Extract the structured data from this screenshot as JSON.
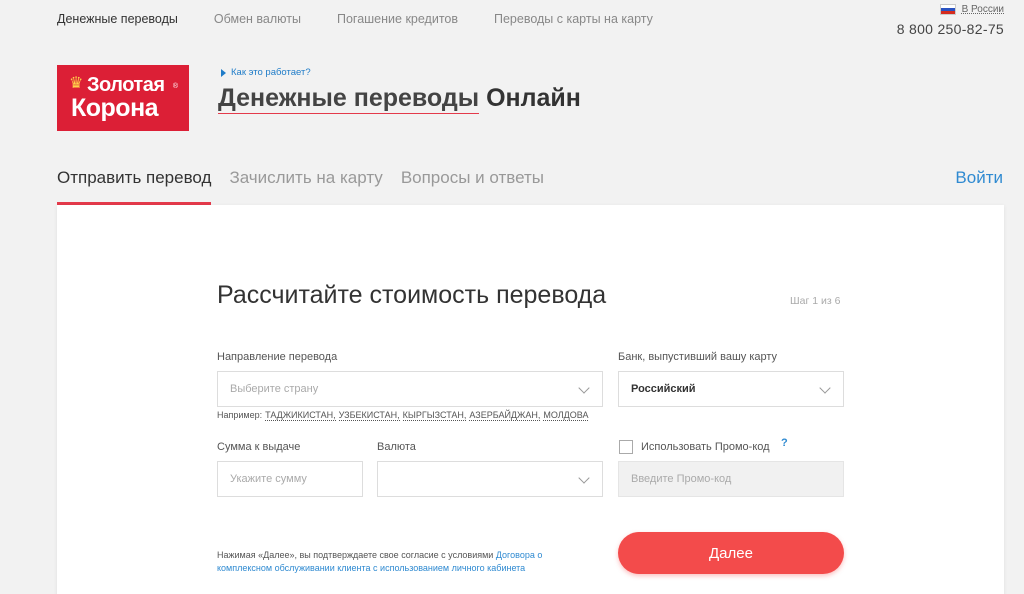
{
  "topnav": {
    "items": [
      "Денежные переводы",
      "Обмен валюты",
      "Погашение кредитов",
      "Переводы с карты на карту"
    ],
    "active_index": 0
  },
  "header": {
    "region": "В России",
    "phone": "8 800 250-82-75",
    "logo": {
      "line1": "Золотая",
      "line2": "Корона",
      "reg": "®"
    },
    "how_link": "Как это работает?",
    "title_part1": "Денежные переводы",
    "title_part2": "Онлайн"
  },
  "tabs": {
    "items": [
      "Отправить перевод",
      "Зачислить на карту",
      "Вопросы и ответы"
    ],
    "active_index": 0,
    "login": "Войти"
  },
  "form": {
    "title": "Рассчитайте стоимость перевода",
    "step": "Шаг 1 из 6",
    "direction": {
      "label": "Направление перевода",
      "placeholder": "Выберите страну"
    },
    "example": {
      "prefix": "Например:",
      "countries": [
        "ТАДЖИКИСТАН,",
        "УЗБЕКИСТАН,",
        "КЫРГЫЗСТАН,",
        "АЗЕРБАЙДЖАН,",
        "МОЛДОВА"
      ]
    },
    "bank": {
      "label": "Банк, выпустивший вашу карту",
      "value": "Российский"
    },
    "amount": {
      "label": "Сумма к выдаче",
      "placeholder": "Укажите сумму"
    },
    "currency": {
      "label": "Валюта",
      "value": ""
    },
    "promo": {
      "label": "Использовать Промо-код",
      "help": "?",
      "placeholder": "Введите Промо-код",
      "checked": false
    },
    "terms": {
      "text": "Нажимая «Далее», вы подтверждаете свое согласие с условиями ",
      "link": "Договора о комплексном обслуживании клиента с использованием личного кабинета"
    },
    "next_button": "Далее"
  },
  "colors": {
    "brand_red": "#dc1f36",
    "accent_red": "#e43a4b",
    "button_red": "#f34b4b",
    "link_blue": "#2f8ad1",
    "crown_gold": "#ffd24a"
  },
  "icons": [
    "crown-icon",
    "flag-icon",
    "chevron-down-icon",
    "triangle-right-icon",
    "checkbox-icon",
    "help-icon"
  ]
}
